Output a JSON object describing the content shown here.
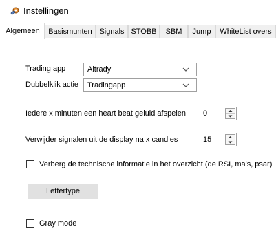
{
  "window": {
    "title": "Instellingen",
    "icon": "gear-wrench-icon"
  },
  "tabs": [
    {
      "label": "Algemeen",
      "active": true
    },
    {
      "label": "Basismunten",
      "active": false
    },
    {
      "label": "Signals",
      "active": false
    },
    {
      "label": "STOBB",
      "active": false
    },
    {
      "label": "SBM",
      "active": false
    },
    {
      "label": "Jump",
      "active": false
    },
    {
      "label": "WhiteList overs",
      "active": false
    }
  ],
  "general": {
    "trading_app_label": "Trading app",
    "trading_app_value": "Altrady",
    "double_click_label": "Dubbelklik actie",
    "double_click_value": "Tradingapp",
    "heartbeat_label": "Iedere x minuten een heart beat geluid afspelen",
    "heartbeat_value": "0",
    "remove_signals_label": "Verwijder signalen uit de display na x candles",
    "remove_signals_value": "15",
    "hide_technical_label": "Verberg de technische informatie in het overzicht (de RSI, ma's, psar)",
    "hide_technical_checked": false,
    "font_button_label": "Lettertype",
    "gray_mode_label": "Gray mode",
    "gray_mode_checked": false
  },
  "colors": {
    "tab_border": "#d9d9d9",
    "control_border": "#a0a0a0",
    "button_face": "#e1e1e1"
  }
}
